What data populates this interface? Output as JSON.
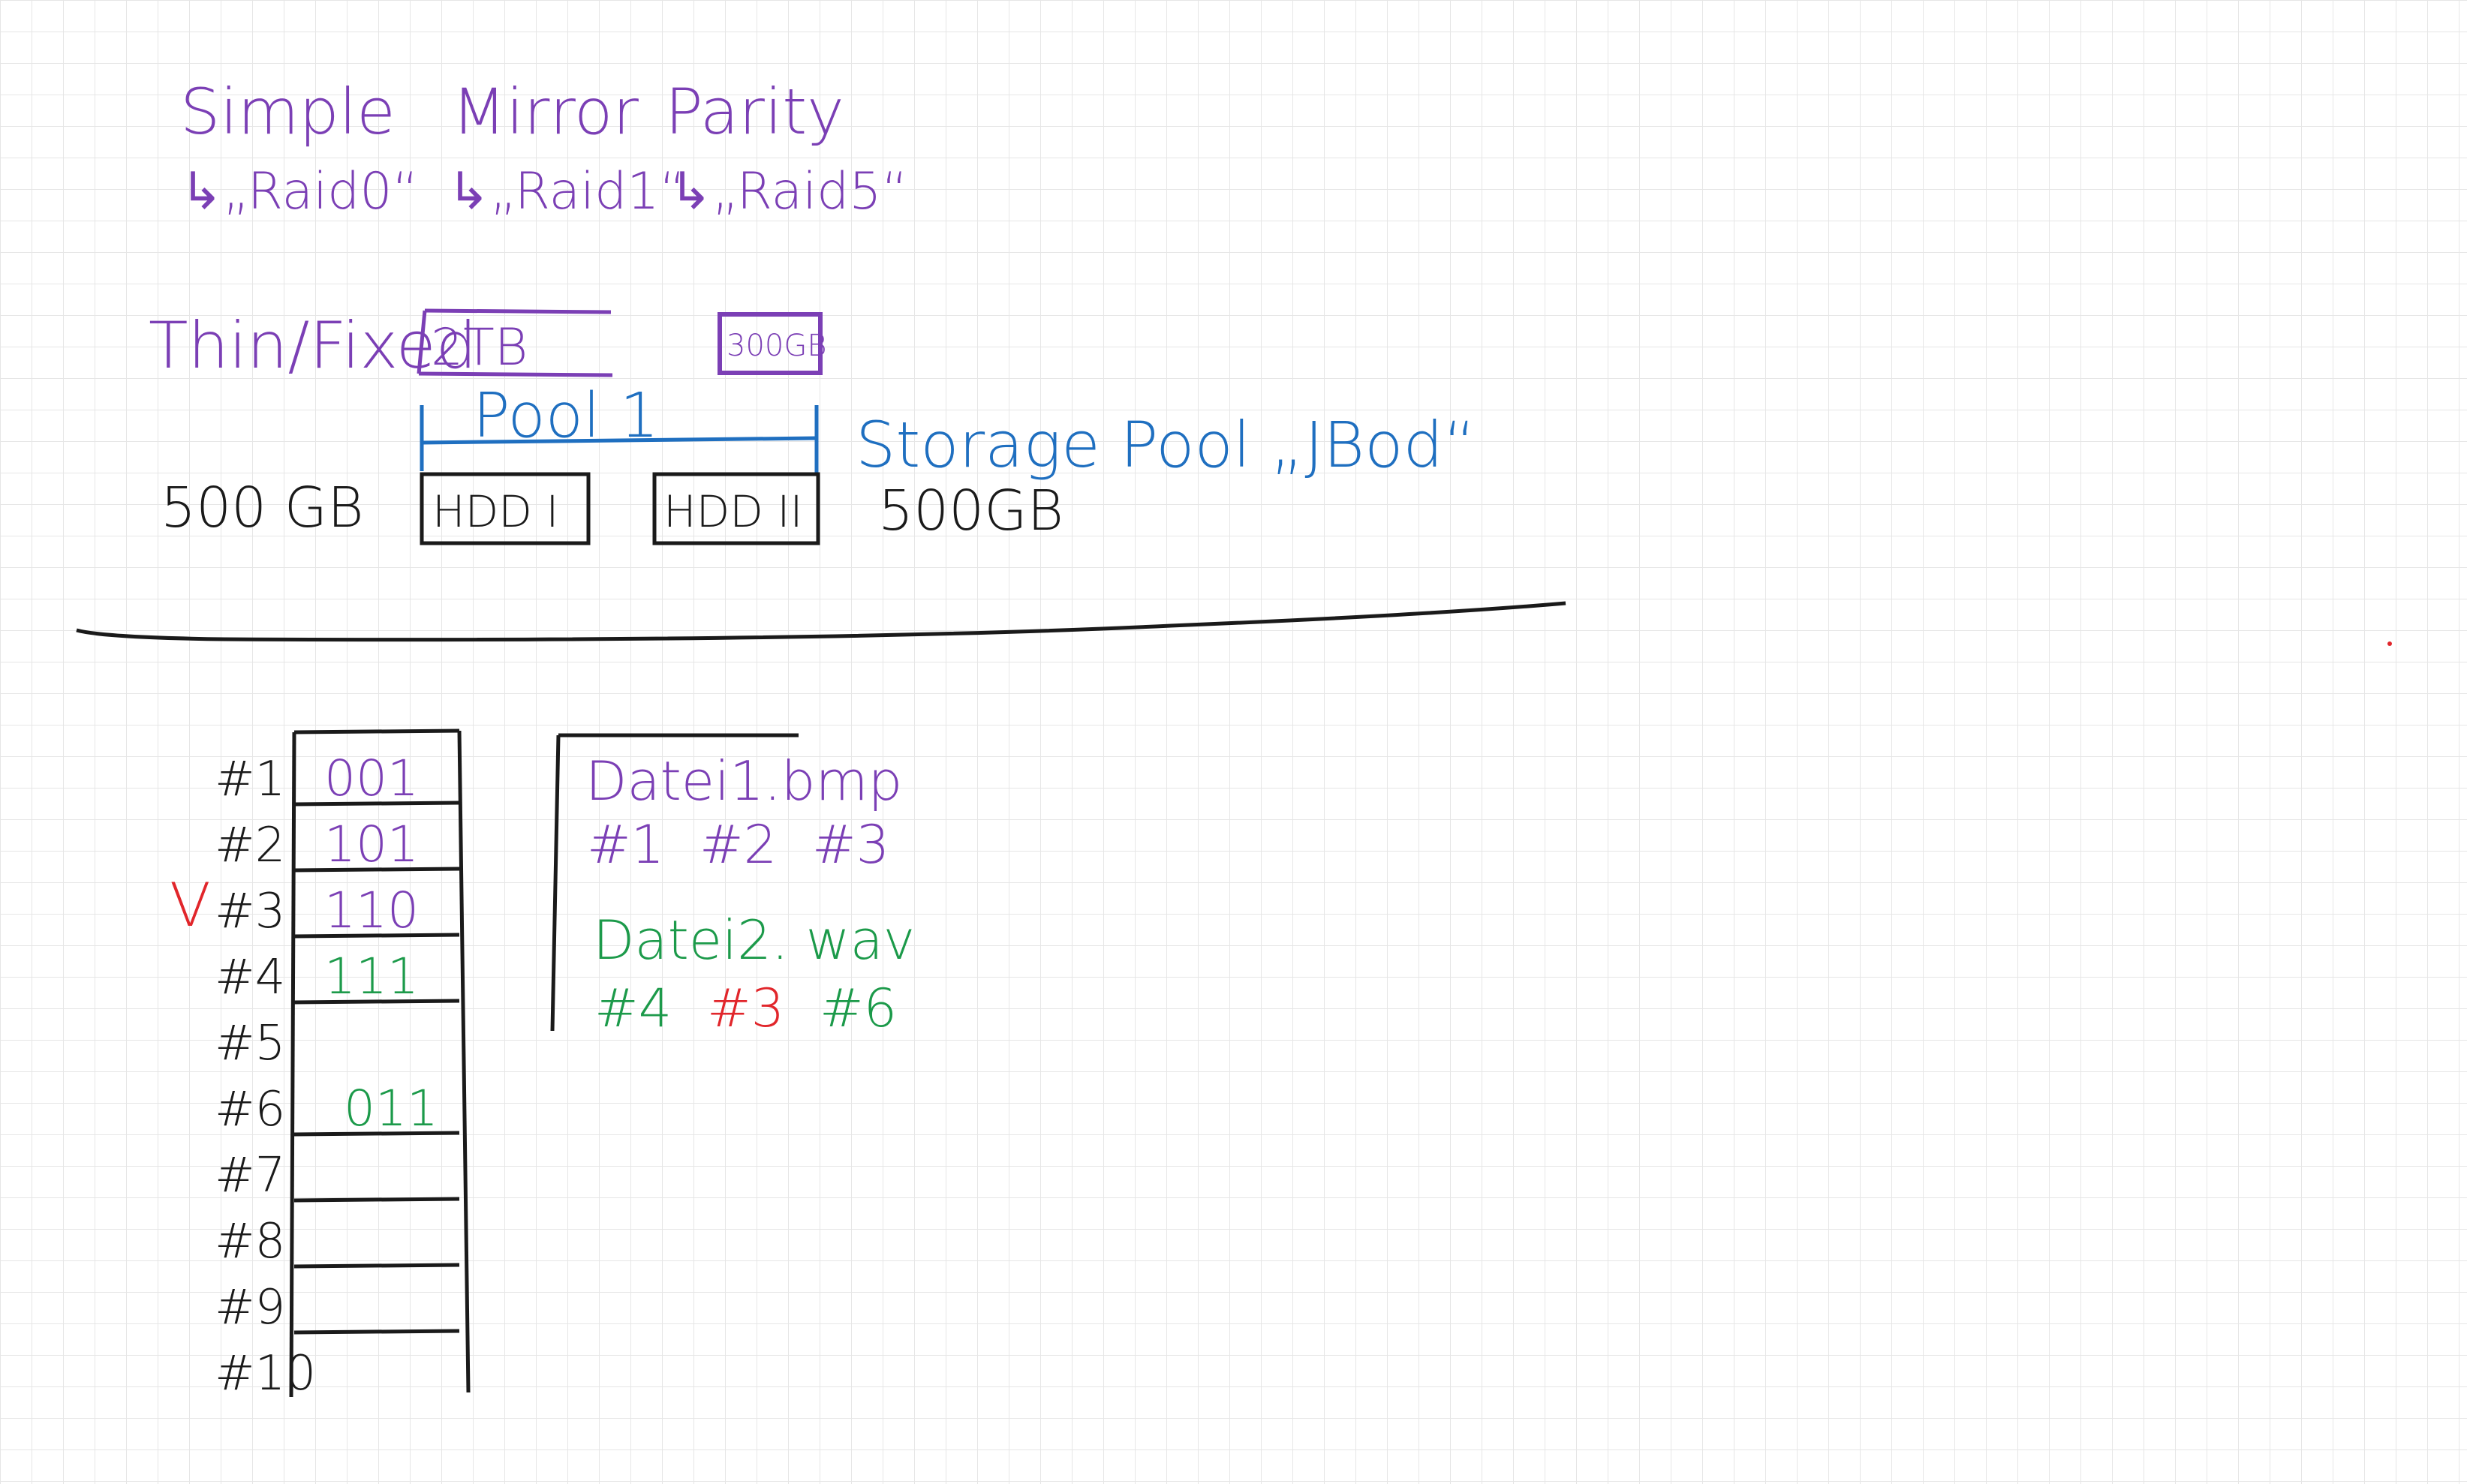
{
  "colors": {
    "purple": "#7b3fb5",
    "blue": "#1f6fc0",
    "black": "#1a1a1a",
    "green": "#1c9a4a",
    "red": "#e1262b",
    "grid": "#e6e6e6",
    "background": "#ffffff"
  },
  "raid_types": [
    {
      "name": "Simple",
      "raid": "↳„Raid0“"
    },
    {
      "name": "Mirror",
      "raid": "↳„Raid1“"
    },
    {
      "name": "Parity",
      "raid": "↳„Raid5“"
    }
  ],
  "provisioning": {
    "label": "Thin/Fixed",
    "size": "2TB",
    "second_size": "300GB"
  },
  "pool": {
    "label": "Pool 1",
    "storage_pool": "Storage Pool „JBod“",
    "left_size": "500 GB",
    "right_size": "500GB",
    "disks": [
      "HDD I",
      "HDD II"
    ]
  },
  "block_table": {
    "rows": [
      {
        "label": "#1",
        "value": "001",
        "color": "purple"
      },
      {
        "label": "#2",
        "value": "101",
        "color": "purple"
      },
      {
        "label": "#3",
        "value": "110",
        "color": "purple"
      },
      {
        "label": "#4",
        "value": "111",
        "color": "green"
      },
      {
        "label": "#5",
        "value": "",
        "color": "green"
      },
      {
        "label": "#6",
        "value": "011",
        "color": "green"
      },
      {
        "label": "#7",
        "value": "",
        "color": "green"
      },
      {
        "label": "#8",
        "value": "",
        "color": "green"
      },
      {
        "label": "#9",
        "value": "",
        "color": "green"
      },
      {
        "label": "#10",
        "value": "",
        "color": "green"
      }
    ],
    "check_mark": "V"
  },
  "files": [
    {
      "name": "Datei1.bmp",
      "blocks": [
        {
          "label": "#1",
          "color": "purple"
        },
        {
          "label": "#2",
          "color": "purple"
        },
        {
          "label": "#3",
          "color": "purple"
        }
      ]
    },
    {
      "name": "Datei2. wav",
      "blocks": [
        {
          "label": "#4",
          "color": "green"
        },
        {
          "label": "#3",
          "color": "red"
        },
        {
          "label": "#6",
          "color": "green"
        }
      ]
    }
  ]
}
